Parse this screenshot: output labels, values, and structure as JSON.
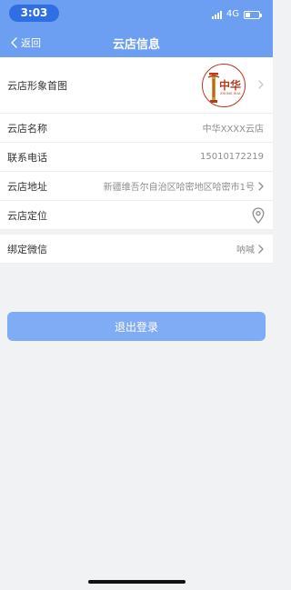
{
  "status_bar": {
    "time": "3:03",
    "network": "4G",
    "battery_level": 0.35
  },
  "nav": {
    "back_label": "返回",
    "title": "云店信息"
  },
  "rows": {
    "image": {
      "label": "云店形象首图"
    },
    "name": {
      "label": "云店名称",
      "value": "中华XXXX云店"
    },
    "phone": {
      "label": "联系电话",
      "value": "15010172219"
    },
    "address": {
      "label": "云店地址",
      "value": "新疆维吾尔自治区哈密地区哈密市1号"
    },
    "location": {
      "label": "云店定位"
    },
    "wechat": {
      "label": "绑定微信",
      "value": "呐喊"
    }
  },
  "logo": {
    "brand_text": "中华",
    "sub_text": "ZHONG HUA"
  },
  "logout_label": "退出登录",
  "colors": {
    "header": "#6c9ef1",
    "time_pill": "#2f6fe3",
    "button": "#80abf5",
    "logo_red": "#b73a1f",
    "logo_gold": "#d59a2a"
  },
  "icons": [
    "back-chevron-icon",
    "chevron-right-icon",
    "location-pin-icon",
    "battery-icon",
    "signal-icon"
  ]
}
